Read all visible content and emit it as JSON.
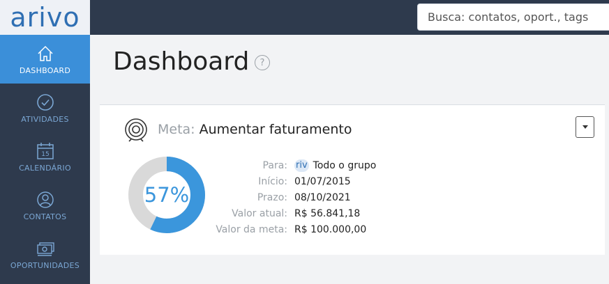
{
  "app": {
    "logo": "arivo"
  },
  "search": {
    "placeholder": "Busca: contatos, oport., tags"
  },
  "sidebar": {
    "items": [
      {
        "label": "DASHBOARD",
        "icon": "home-icon",
        "active": true
      },
      {
        "label": "ATIVIDADES",
        "icon": "check-circle-icon"
      },
      {
        "label": "CALENDÁRIO",
        "icon": "calendar-icon",
        "day": "15"
      },
      {
        "label": "CONTATOS",
        "icon": "user-icon"
      },
      {
        "label": "OPORTUNIDADES",
        "icon": "money-icon"
      }
    ]
  },
  "page": {
    "title": "Dashboard",
    "help": "?"
  },
  "goal": {
    "meta_label": "Meta:",
    "name": "Aumentar faturamento",
    "percent": 57,
    "percent_label": "57%",
    "fields": [
      {
        "label": "Para:",
        "value": "Todo o grupo",
        "badge": "riv"
      },
      {
        "label": "Início:",
        "value": "01/07/2015"
      },
      {
        "label": "Prazo:",
        "value": "08/10/2021"
      },
      {
        "label": "Valor atual:",
        "value": "R$ 56.841,18"
      },
      {
        "label": "Valor da meta:",
        "value": "R$ 100.000,00"
      }
    ]
  },
  "colors": {
    "accent": "#3b8fd9",
    "sidebar_bg": "#2e3a4d",
    "donut_fill": "#3b96dc",
    "donut_track": "#d9d9d9"
  }
}
